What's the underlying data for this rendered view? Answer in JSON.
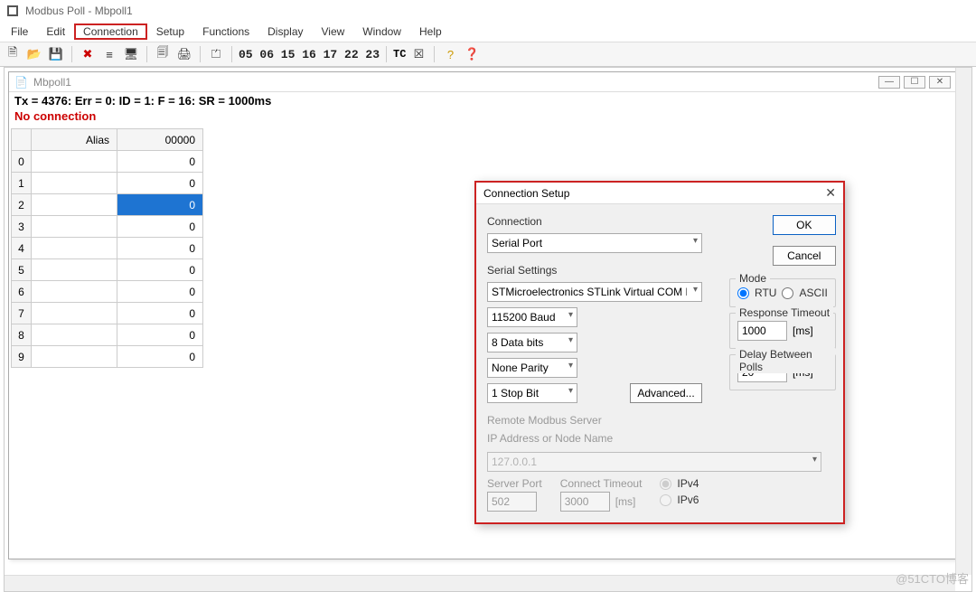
{
  "window": {
    "title": "Modbus Poll - Mbpoll1"
  },
  "menu": {
    "items": [
      "File",
      "Edit",
      "Connection",
      "Setup",
      "Functions",
      "Display",
      "View",
      "Window",
      "Help"
    ],
    "highlighted": "Connection"
  },
  "toolbar": {
    "numstrip": "05 06 15 16 17 22 23",
    "tc": "TC"
  },
  "doc": {
    "title": "Mbpoll1",
    "status_line": "Tx = 4376: Err = 0: ID = 1: F = 16: SR = 1000ms",
    "no_conn": "No connection",
    "headers": {
      "alias": "Alias",
      "val": "00000"
    },
    "rows": [
      {
        "n": "0",
        "a": "",
        "v": "0"
      },
      {
        "n": "1",
        "a": "",
        "v": "0"
      },
      {
        "n": "2",
        "a": "",
        "v": "0"
      },
      {
        "n": "3",
        "a": "",
        "v": "0"
      },
      {
        "n": "4",
        "a": "",
        "v": "0"
      },
      {
        "n": "5",
        "a": "",
        "v": "0"
      },
      {
        "n": "6",
        "a": "",
        "v": "0"
      },
      {
        "n": "7",
        "a": "",
        "v": "0"
      },
      {
        "n": "8",
        "a": "",
        "v": "0"
      },
      {
        "n": "9",
        "a": "",
        "v": "0"
      }
    ],
    "selected_row": 2
  },
  "dialog": {
    "title": "Connection Setup",
    "ok": "OK",
    "cancel": "Cancel",
    "conn_label": "Connection",
    "conn_value": "Serial Port",
    "serial_label": "Serial Settings",
    "port": "STMicroelectronics STLink Virtual COM Port (CC",
    "baud": "115200 Baud",
    "databits": "8 Data bits",
    "parity": "None Parity",
    "stopbit": "1 Stop Bit",
    "advanced": "Advanced...",
    "mode_label": "Mode",
    "mode_rtu": "RTU",
    "mode_ascii": "ASCII",
    "resp_label": "Response Timeout",
    "resp_value": "1000",
    "resp_unit": "[ms]",
    "delay_label": "Delay Between Polls",
    "delay_value": "20",
    "delay_unit": "[ms]",
    "remote_label": "Remote Modbus Server",
    "ip_label": "IP Address or Node Name",
    "ip_value": "127.0.0.1",
    "sport_label": "Server Port",
    "sport_value": "502",
    "ctimeout_label": "Connect Timeout",
    "ctimeout_value": "3000",
    "ctimeout_unit": "[ms]",
    "ipv4": "IPv4",
    "ipv6": "IPv6"
  },
  "watermark": "@51CTO博客"
}
